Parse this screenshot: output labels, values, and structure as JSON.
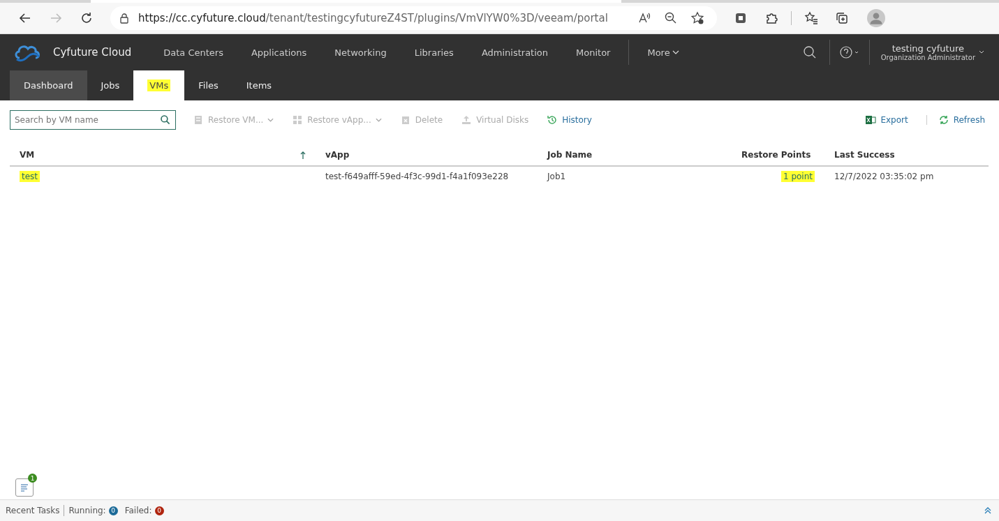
{
  "browser": {
    "url_host": "https://cc.cyfuture.cloud",
    "url_path": "/tenant/testingcyfutureZ4ST/plugins/VmVlYW0%3D/veeam/portal"
  },
  "header": {
    "brand": "Cyfuture Cloud",
    "nav": [
      "Data Centers",
      "Applications",
      "Networking",
      "Libraries",
      "Administration",
      "Monitor"
    ],
    "more": "More",
    "user_name": "testing cyfuture",
    "user_role": "Organization Administrator"
  },
  "tabs": [
    {
      "label": "Dashboard",
      "selected": false,
      "highlighted": false
    },
    {
      "label": "Jobs",
      "selected": false,
      "highlighted": false
    },
    {
      "label": "VMs",
      "selected": true,
      "highlighted": true
    },
    {
      "label": "Files",
      "selected": false,
      "highlighted": false
    },
    {
      "label": "Items",
      "selected": false,
      "highlighted": false
    }
  ],
  "search": {
    "placeholder": "Search by VM name"
  },
  "actions": [
    {
      "label": "Restore VM...",
      "kind": "restore-vm",
      "disabled": true,
      "dropdown": true
    },
    {
      "label": "Restore vApp...",
      "kind": "restore-vapp",
      "disabled": true,
      "dropdown": true
    },
    {
      "label": "Delete",
      "kind": "delete",
      "disabled": true,
      "dropdown": false
    },
    {
      "label": "Virtual Disks",
      "kind": "disks",
      "disabled": true,
      "dropdown": false
    },
    {
      "label": "History",
      "kind": "history",
      "disabled": false,
      "dropdown": false
    }
  ],
  "right_actions": [
    {
      "label": "Export",
      "kind": "export"
    },
    {
      "label": "Refresh",
      "kind": "refresh"
    }
  ],
  "table": {
    "columns": [
      "VM",
      "vApp",
      "Job Name",
      "Restore Points",
      "Last Success"
    ],
    "rows": [
      {
        "vm": "test",
        "vm_highlighted": true,
        "vapp": "test-f649afff-59ed-4f3c-99d1-f4a1f093e228",
        "job": "Job1",
        "points": "1 point",
        "points_highlighted": true,
        "last_success": "12/7/2022 03:35:02 pm"
      }
    ]
  },
  "footer": {
    "tasks_badge": "1",
    "recent_tasks": "Recent Tasks",
    "running_label": "Running:",
    "running": "0",
    "failed_label": "Failed:",
    "failed": "0"
  }
}
